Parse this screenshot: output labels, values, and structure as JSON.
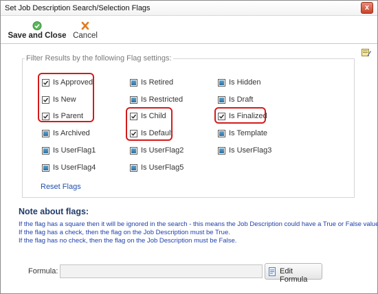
{
  "window": {
    "title": "Set Job Description Search/Selection Flags",
    "close_label": "x"
  },
  "toolbar": {
    "save_label": "Save and Close",
    "cancel_label": "Cancel"
  },
  "flag_panel": {
    "legend": "Filter Results by the following Flag settings:",
    "flags": [
      {
        "label": "Is Approved",
        "state": "check"
      },
      {
        "label": "Is New",
        "state": "check"
      },
      {
        "label": "Is Parent",
        "state": "check"
      },
      {
        "label": "Is Archived",
        "state": "square"
      },
      {
        "label": "Is UserFlag1",
        "state": "square"
      },
      {
        "label": "Is UserFlag4",
        "state": "square"
      },
      {
        "label": "Is Retired",
        "state": "square"
      },
      {
        "label": "Is Restricted",
        "state": "square"
      },
      {
        "label": "Is Child",
        "state": "check"
      },
      {
        "label": "Is Default",
        "state": "check"
      },
      {
        "label": "Is UserFlag2",
        "state": "square"
      },
      {
        "label": "Is UserFlag5",
        "state": "square"
      },
      {
        "label": "Is Hidden",
        "state": "square"
      },
      {
        "label": "Is Draft",
        "state": "square"
      },
      {
        "label": "Is Finalized",
        "state": "check"
      },
      {
        "label": "Is Template",
        "state": "square"
      },
      {
        "label": "Is UserFlag3",
        "state": "square"
      }
    ],
    "reset_label": "Reset Flags"
  },
  "notes": {
    "title": "Note about flags:",
    "lines": [
      "If the flag has a square then it will be ignored in the search - this means the Job Description could have a True or False value.",
      "If the flag has a check, then the flag on the Job Description must be True.",
      "If the flag has no check, then the flag on the Job Description must be False."
    ]
  },
  "formula": {
    "label": "Formula:",
    "value": "",
    "edit_label": "Edit Formula"
  },
  "colors": {
    "highlight": "#d41a1a",
    "note_text": "#1e3fa8",
    "note_title": "#1f3a68",
    "link": "#1f4fae",
    "square_fill": "#2a6e9e"
  }
}
